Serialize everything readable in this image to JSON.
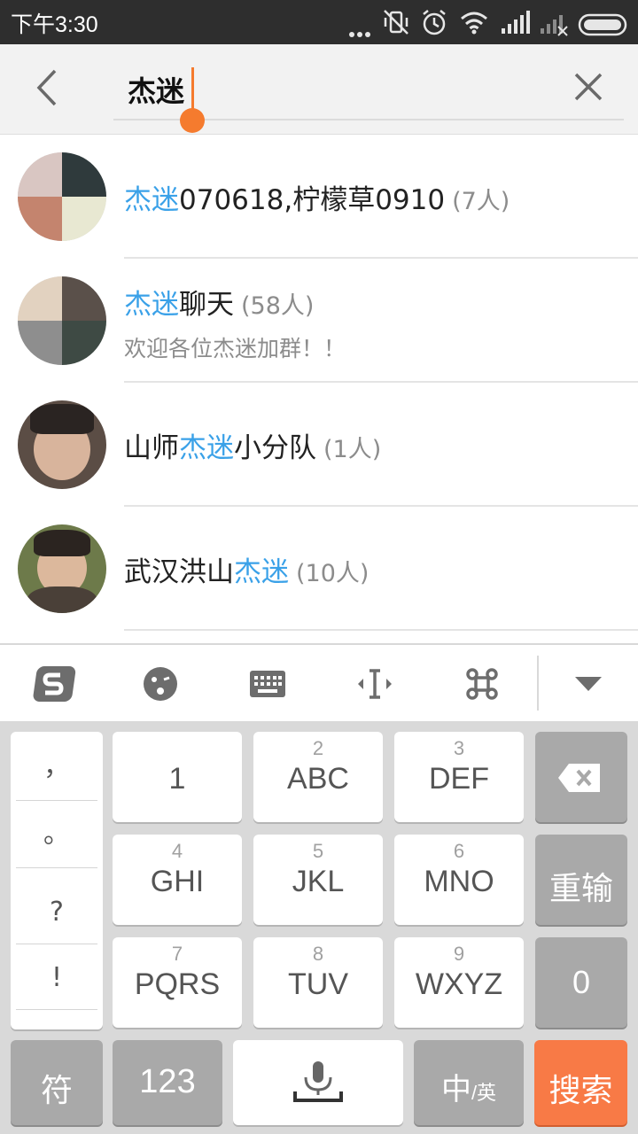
{
  "status_bar": {
    "time": "下午3:30",
    "icons": [
      "more-dots-icon",
      "vibrate-off-icon",
      "alarm-icon",
      "wifi-icon",
      "signal-icon",
      "signal-no-sim-icon",
      "battery-icon"
    ]
  },
  "search": {
    "query": "杰迷",
    "back_icon": "chevron-left-icon",
    "clear_icon": "close-icon"
  },
  "results": [
    {
      "prefix": "",
      "highlight": "杰迷",
      "suffix": "070618,柠檬草0910",
      "count": "(7人)",
      "subtitle": ""
    },
    {
      "prefix": "",
      "highlight": "杰迷",
      "suffix": "聊天",
      "count": "(58人)",
      "subtitle": "欢迎各位杰迷加群！！"
    },
    {
      "prefix": "山师",
      "highlight": "杰迷",
      "suffix": "小分队",
      "count": "(1人)",
      "subtitle": ""
    },
    {
      "prefix": "武汉洪山",
      "highlight": "杰迷",
      "suffix": "",
      "count": "(10人)",
      "subtitle": ""
    }
  ],
  "toolbar": {
    "items": [
      "sogou-logo-icon",
      "emoji-icon",
      "keyboard-icon",
      "cursor-move-icon",
      "command-icon",
      "collapse-arrow-icon"
    ]
  },
  "keyboard": {
    "punctuation": [
      "，",
      "。",
      "?",
      "!"
    ],
    "keys": [
      {
        "num": "",
        "letters": "1"
      },
      {
        "num": "2",
        "letters": "ABC"
      },
      {
        "num": "3",
        "letters": "DEF"
      },
      {
        "num": "4",
        "letters": "GHI"
      },
      {
        "num": "5",
        "letters": "JKL"
      },
      {
        "num": "6",
        "letters": "MNO"
      },
      {
        "num": "7",
        "letters": "PQRS"
      },
      {
        "num": "8",
        "letters": "TUV"
      },
      {
        "num": "9",
        "letters": "WXYZ"
      }
    ],
    "reenter": "重输",
    "zero": "0",
    "symbol": "符",
    "numeric": "123",
    "lang_main": "中",
    "lang_sub": "/英",
    "search": "搜索"
  },
  "colors": {
    "highlight": "#3aa1e8",
    "accent": "#f57b2e",
    "search_key": "#f87a46"
  }
}
